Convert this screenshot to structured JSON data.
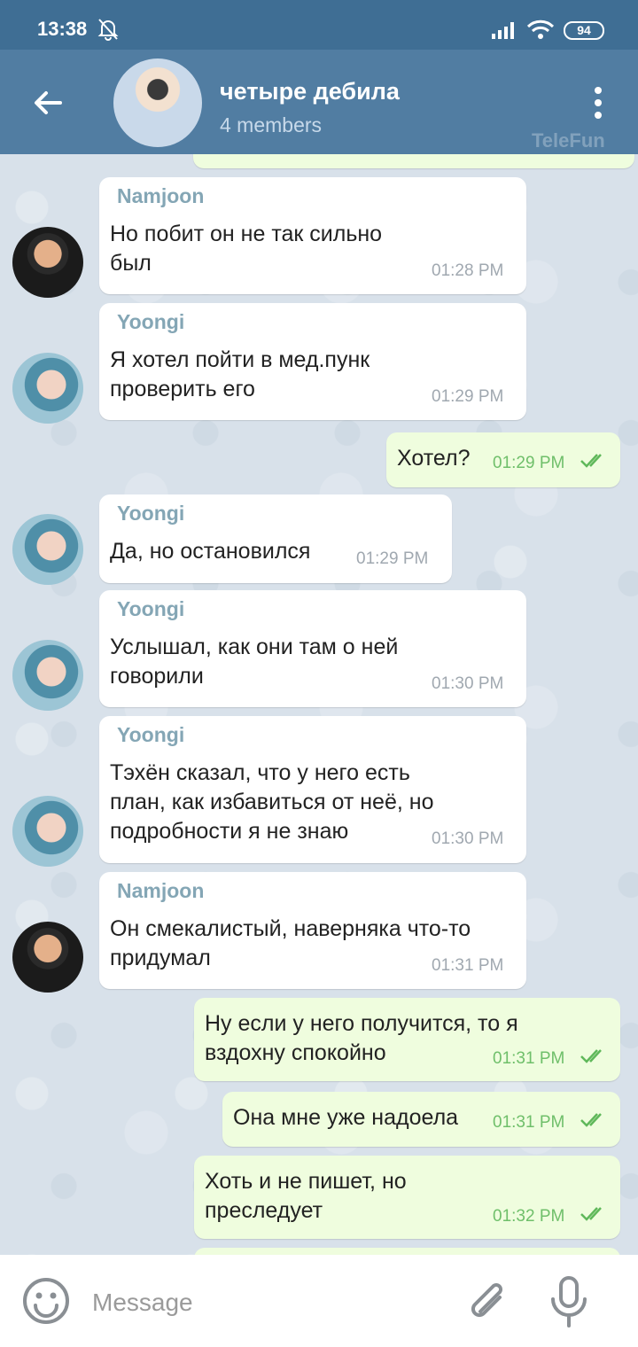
{
  "status_bar": {
    "time": "13:38",
    "battery": "94"
  },
  "header": {
    "title": "четыре дебила",
    "subtitle": "4 members",
    "watermark": "TeleFun"
  },
  "messages": [
    {
      "sender": "Namjoon",
      "text": "Но побит он не так сильно\nбыл",
      "time": "01:28 PM"
    },
    {
      "sender": "Yoongi",
      "text": "Я хотел пойти в мед.пунк\nпроверить его",
      "time": "01:29 PM"
    },
    {
      "text": "Хотел?",
      "time": "01:29 PM"
    },
    {
      "sender": "Yoongi",
      "text": "Да, но остановился",
      "time": "01:29 PM"
    },
    {
      "sender": "Yoongi",
      "text": "Услышал, как они там о ней\nговорили",
      "time": "01:30 PM"
    },
    {
      "sender": "Yoongi",
      "text": "Тэхён сказал, что у него есть\nплан, как избавиться от неё, но\nподробности я не знаю",
      "time": "01:30 PM"
    },
    {
      "sender": "Namjoon",
      "text": "Он смекалистый, наверняка что-то\nпридумал",
      "time": "01:31 PM"
    },
    {
      "text": "Ну если у него получится, то я\nвздохну спокойно",
      "time": "01:31 PM"
    },
    {
      "text": "Она мне уже надоела",
      "time": "01:31 PM"
    },
    {
      "text": "Хоть и не пишет, но\nпреследует",
      "time": "01:32 PM"
    }
  ],
  "input": {
    "placeholder": "Message"
  },
  "colors": {
    "header": "#517da2",
    "status_bar": "#3f6e94",
    "outgoing_bubble": "#effdde",
    "incoming_bubble": "#ffffff",
    "sender_name": "#84a6b5",
    "read_ticks": "#5fb85a"
  },
  "icons": [
    "bell-off-icon",
    "signal-icon",
    "wifi-icon",
    "battery-icon",
    "back-arrow-icon",
    "more-vertical-icon",
    "double-check-icon",
    "emoji-icon",
    "attach-icon",
    "mic-icon"
  ]
}
